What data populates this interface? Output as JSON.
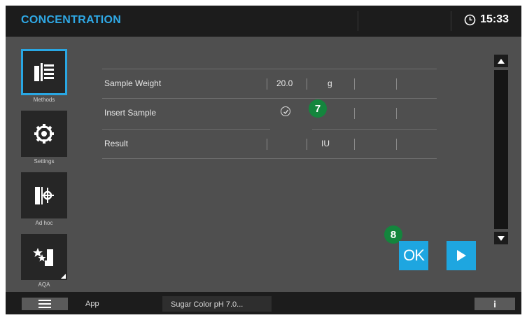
{
  "header": {
    "title": "CONCENTRATION",
    "time": "15:33"
  },
  "sidebar": {
    "items": [
      {
        "label": "Methods",
        "icon": "methods-list-icon",
        "active": true
      },
      {
        "label": "Settings",
        "icon": "gear-icon",
        "active": false
      },
      {
        "label": "Ad hoc",
        "icon": "ad-hoc-icon",
        "active": false
      },
      {
        "label": "AQA",
        "icon": "aqa-stars-icon",
        "active": false
      }
    ]
  },
  "table": {
    "rows": [
      {
        "label": "Sample Weight",
        "value": "20.0",
        "unit": "g"
      },
      {
        "label": "Insert Sample",
        "value": "",
        "unit": ""
      },
      {
        "label": "Result",
        "value": "",
        "unit": "IU"
      }
    ]
  },
  "actions": {
    "ok_label": "OK"
  },
  "annotations": {
    "step7": "7",
    "step8": "8"
  },
  "footer": {
    "app_label": "App",
    "method_name": "Sugar Color pH 7.0...",
    "info_label": "i"
  },
  "colors": {
    "accent": "#1ea6e0",
    "badge": "#14853d",
    "title": "#2fa9e6"
  }
}
